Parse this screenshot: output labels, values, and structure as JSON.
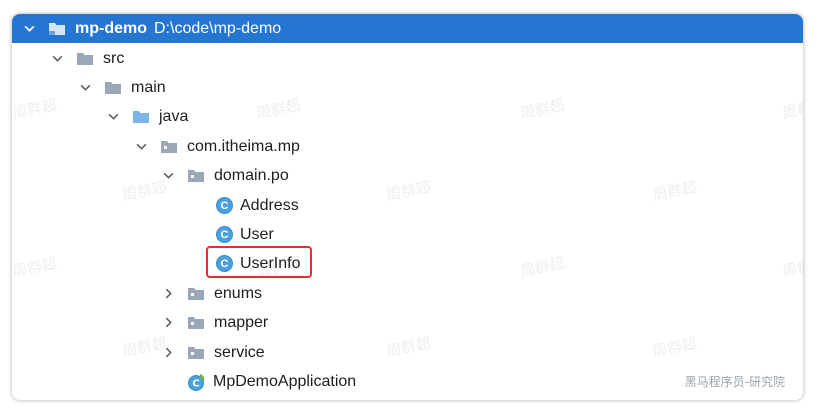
{
  "tree": {
    "root": {
      "name": "mp-demo",
      "path": "D:\\code\\mp-demo"
    },
    "items": [
      {
        "label": "src",
        "type": "folder",
        "expanded": true
      },
      {
        "label": "main",
        "type": "folder",
        "expanded": true
      },
      {
        "label": "java",
        "type": "source-folder",
        "expanded": true
      },
      {
        "label": "com.itheima.mp",
        "type": "package",
        "expanded": true
      },
      {
        "label": "domain.po",
        "type": "package",
        "expanded": true
      },
      {
        "label": "Address",
        "type": "class"
      },
      {
        "label": "User",
        "type": "class"
      },
      {
        "label": "UserInfo",
        "type": "class",
        "highlighted": true
      },
      {
        "label": "enums",
        "type": "package",
        "expanded": false
      },
      {
        "label": "mapper",
        "type": "package",
        "expanded": false
      },
      {
        "label": "service",
        "type": "package",
        "expanded": false
      },
      {
        "label": "MpDemoApplication",
        "type": "spring-boot-app"
      }
    ],
    "class_icon_letter": "C"
  },
  "watermark": {
    "text": "周群超"
  },
  "corner_watermark": "黑马程序员-研究院",
  "colors": {
    "selection": "#2575d3",
    "class_icon": "#4aa1dd",
    "highlight_border": "#e0312b",
    "folder": "#9aa7b6",
    "source_folder": "#7cb6e6"
  }
}
